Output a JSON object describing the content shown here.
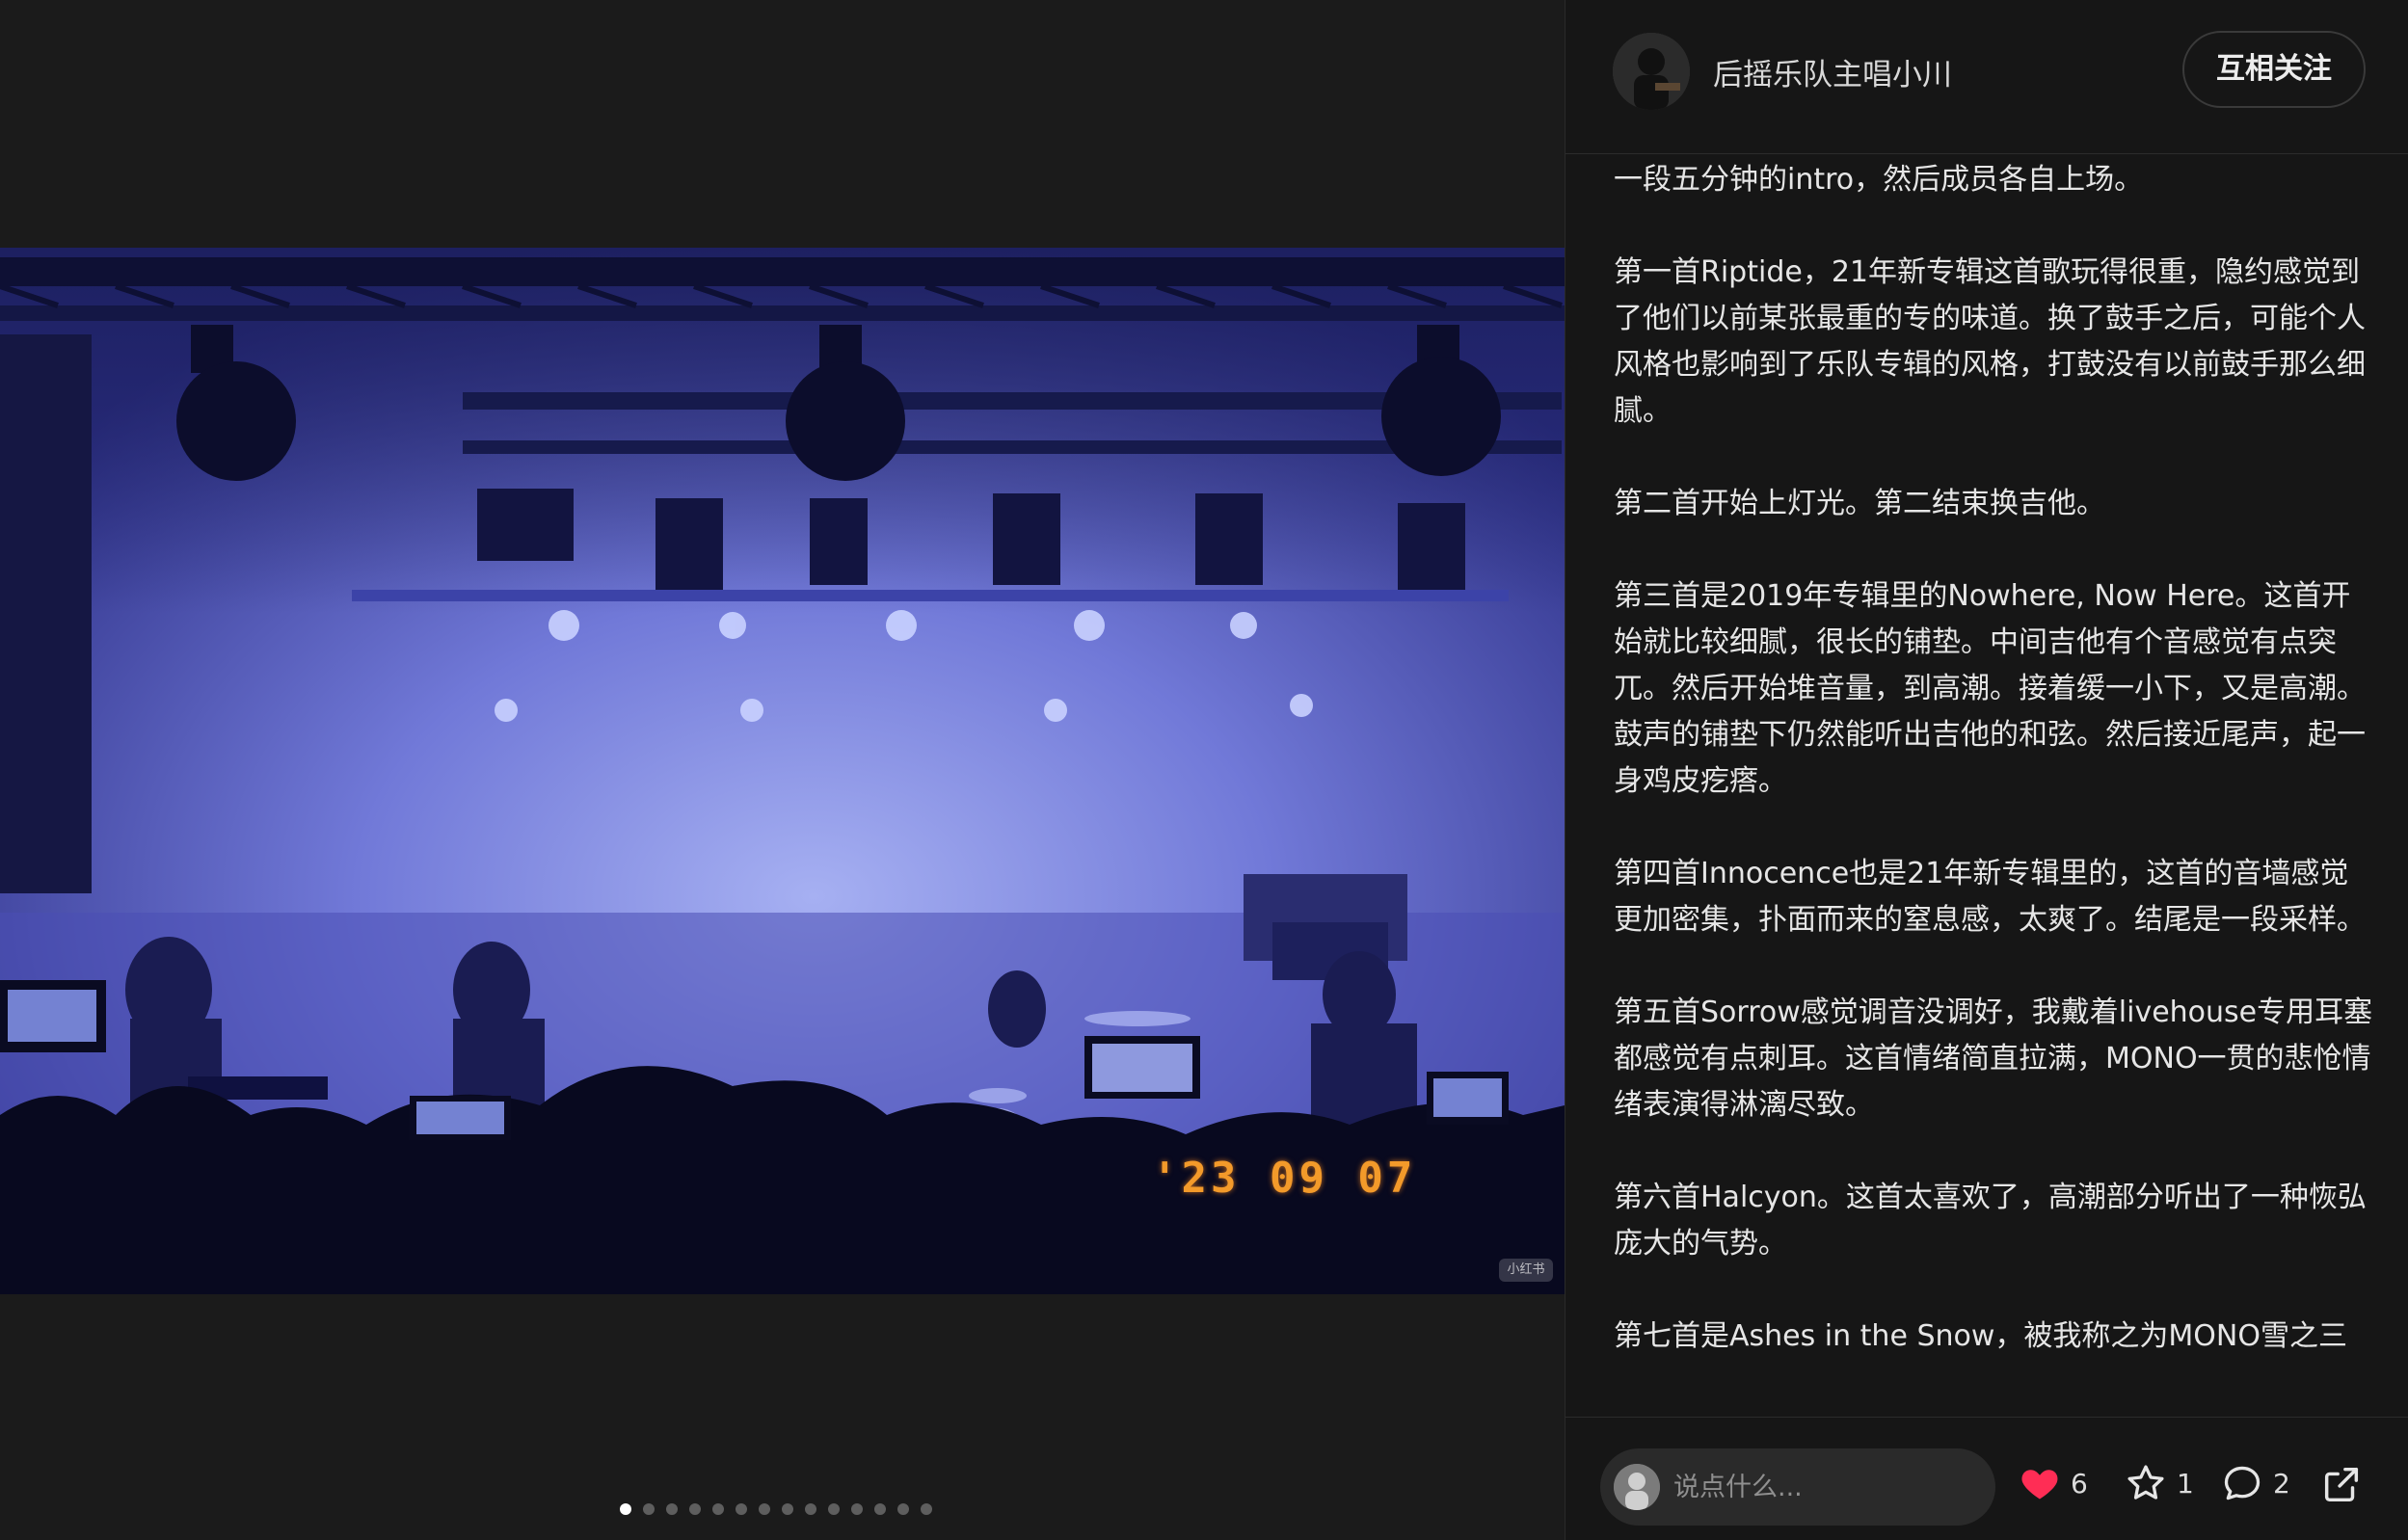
{
  "post": {
    "date_stamp": "'23 09 07",
    "watermark": "小红书",
    "slide_count": 14,
    "active_slide": 1
  },
  "author": {
    "name": "后摇乐队主唱小川",
    "follow_label": "互相关注"
  },
  "body": {
    "paragraphs": [
      "一段五分钟的intro，然后成员各自上场。",
      "第一首Riptide，21年新专辑这首歌玩得很重，隐约感觉到了他们以前某张最重的专的味道。换了鼓手之后，可能个人风格也影响到了乐队专辑的风格，打鼓没有以前鼓手那么细腻。",
      "第二首开始上灯光。第二结束换吉他。",
      "第三首是2019年专辑里的Nowhere, Now Here。这首开始就比较细腻，很长的铺垫。中间吉他有个音感觉有点突兀。然后开始堆音量，到高潮。接着缓一小下，又是高潮。鼓声的铺垫下仍然能听出吉他的和弦。然后接近尾声，起一身鸡皮疙瘩。",
      "第四首Innocence也是21年新专辑里的，这首的音墙感觉更加密集，扑面而来的窒息感，太爽了。结尾是一段采样。",
      "第五首Sorrow感觉调音没调好，我戴着livehouse专用耳塞都感觉有点刺耳。这首情绪简直拉满，MONO一贯的悲怆情绪表演得淋漓尽致。",
      "第六首Halcyon。这首太喜欢了，高潮部分听出了一种恢弘庞大的气势。",
      "第七首是Ashes in the Snow，被我称之为MONO雪之三"
    ]
  },
  "footer": {
    "comment_placeholder": "说点什么...",
    "likes": "6",
    "favorites": "1",
    "comments": "2",
    "like_color": "#ff2d55"
  }
}
